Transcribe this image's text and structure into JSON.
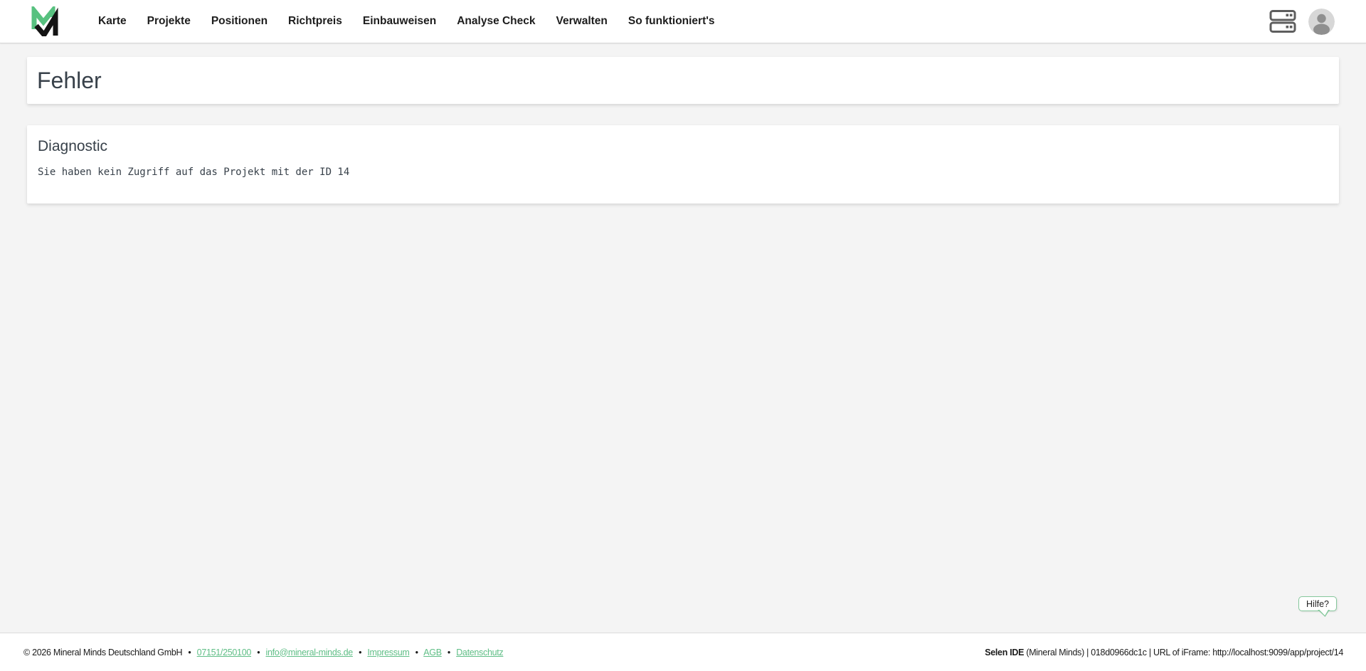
{
  "nav": {
    "items": [
      {
        "label": "Karte"
      },
      {
        "label": "Projekte"
      },
      {
        "label": "Positionen"
      },
      {
        "label": "Richtpreis"
      },
      {
        "label": "Einbauweisen"
      },
      {
        "label": "Analyse Check"
      },
      {
        "label": "Verwalten"
      },
      {
        "label": "So funktioniert's"
      }
    ]
  },
  "header": {
    "logo": {
      "name": "mineral-minds-logo",
      "green": "#57c17f",
      "black": "#141414"
    },
    "icons": [
      {
        "name": "storage-icon",
        "color": "#5e5e5e"
      },
      {
        "name": "user-avatar",
        "bg": "#d7d7d7",
        "fg": "#8f8f8f"
      }
    ]
  },
  "main": {
    "error_title": "Fehler",
    "diagnostic": {
      "title": "Diagnostic",
      "message": "Sie haben kein Zugriff auf das Projekt mit der ID 14"
    }
  },
  "help": {
    "label": "Hilfe?",
    "border_color": "#86c89c"
  },
  "footer": {
    "copyright": "© 2026 Mineral Minds Deutschland GmbH",
    "separator": "•",
    "links": [
      {
        "label": "07151/250100"
      },
      {
        "label": "info@mineral-minds.de"
      },
      {
        "label": "Impressum"
      },
      {
        "label": "AGB"
      },
      {
        "label": "Datenschutz"
      }
    ],
    "system": {
      "app_name": "Selen IDE",
      "details": " (Mineral Minds) | 018d0966dc1c | URL of iFrame: http://localhost:9099/app/project/14"
    }
  },
  "colors": {
    "accent_green": "#5fbe86",
    "page_bg": "#f4f4f4",
    "text_dark": "#38414a"
  }
}
